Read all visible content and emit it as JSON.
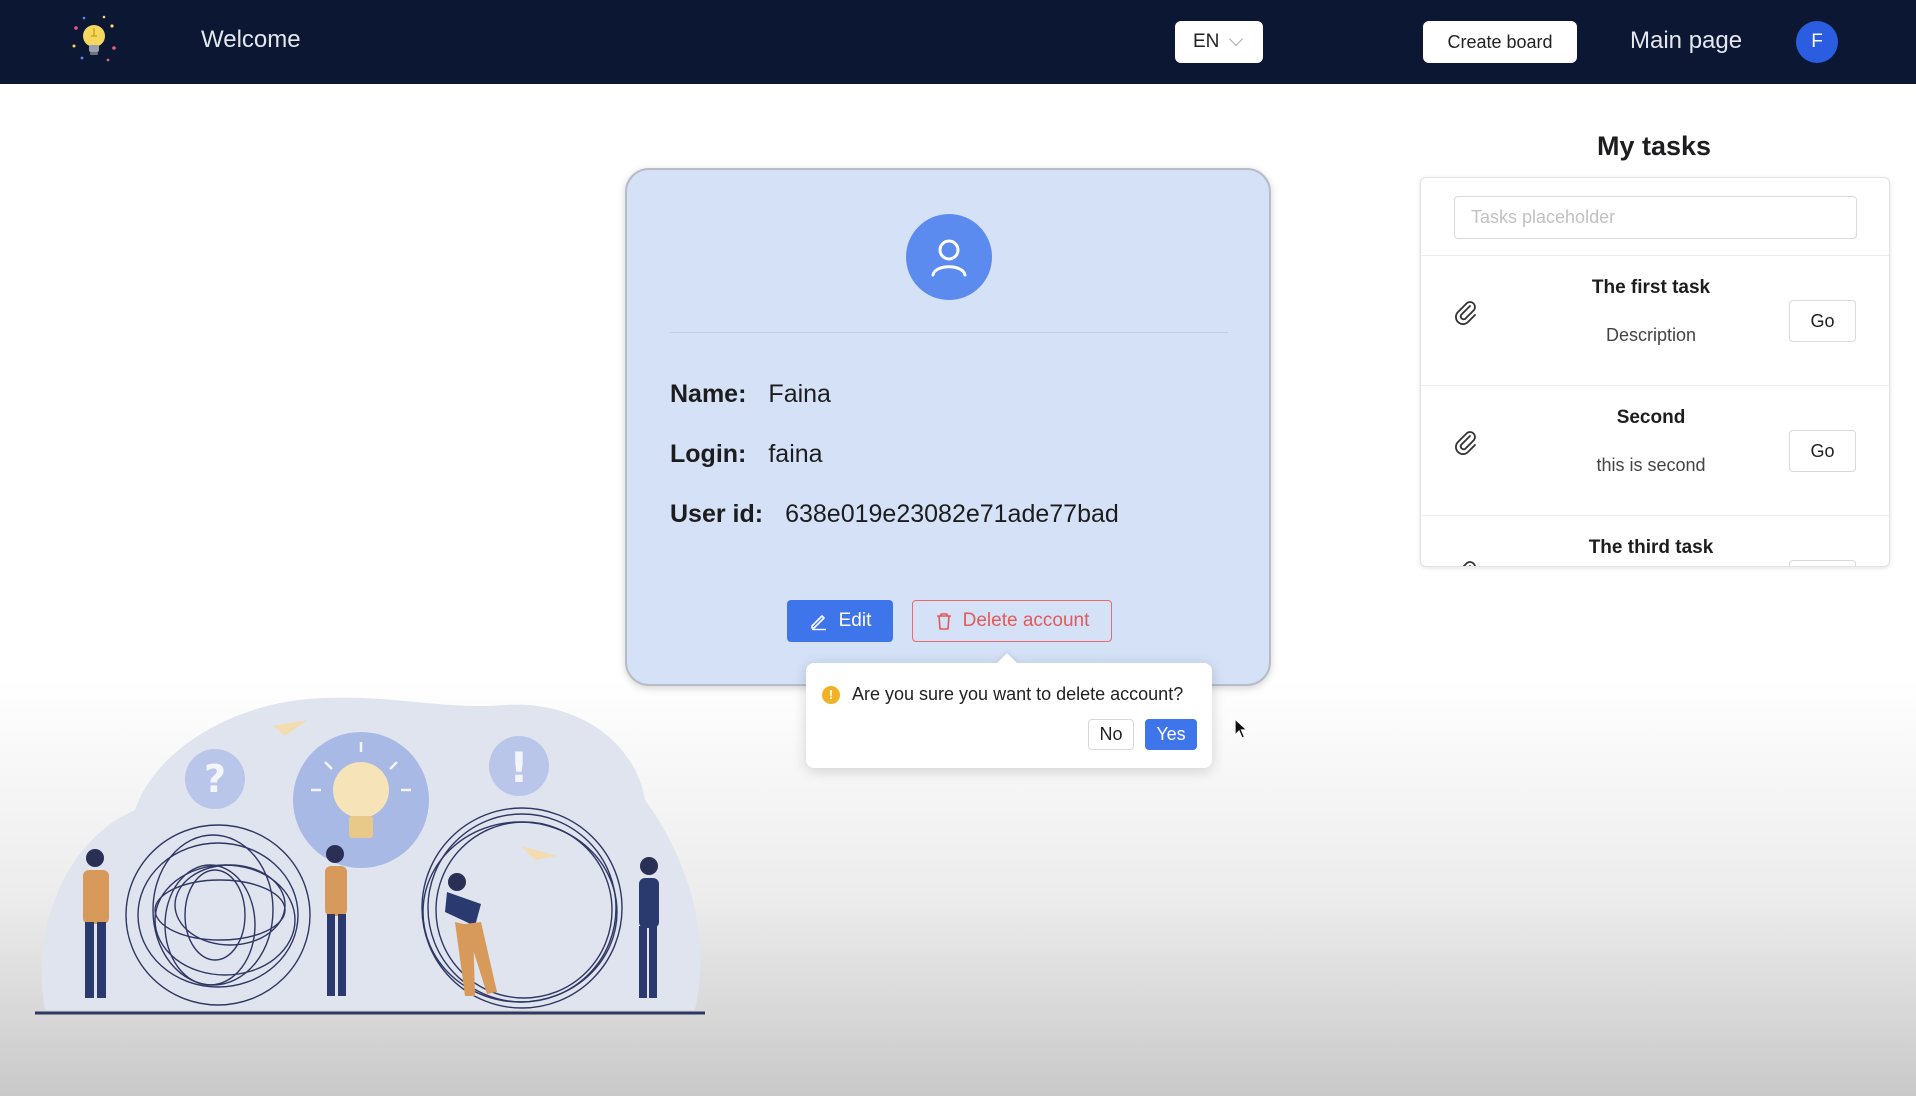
{
  "header": {
    "welcome": "Welcome",
    "language": "EN",
    "create_board": "Create board",
    "main_page": "Main page",
    "user_initial": "F"
  },
  "profile": {
    "name_label": "Name:",
    "name_value": "Faina",
    "login_label": "Login:",
    "login_value": "faina",
    "userid_label": "User id:",
    "userid_value": "638e019e23082e71ade77bad",
    "edit_label": "Edit",
    "delete_label": "Delete account"
  },
  "confirm": {
    "message": "Are you sure you want to delete account?",
    "no_label": "No",
    "yes_label": "Yes"
  },
  "tasks": {
    "title": "My tasks",
    "search_placeholder": "Tasks placeholder",
    "items": [
      {
        "title": "The first task",
        "description": "Description",
        "go_label": "Go"
      },
      {
        "title": "Second",
        "description": "this is second",
        "go_label": "Go"
      },
      {
        "title": "The third task",
        "description": "",
        "go_label": "Go"
      }
    ]
  },
  "colors": {
    "header_bg": "#0b1733",
    "card_bg": "#d4e1f6",
    "accent": "#3f75ea",
    "danger": "#e25a5a",
    "warning": "#f1b226"
  },
  "icons": {
    "logo": "lightbulb-logo-icon",
    "avatar": "user-icon",
    "edit": "pencil-icon",
    "delete": "trash-icon",
    "warning": "exclamation-circle-icon",
    "task": "paperclip-icon",
    "language": "chevron-down-icon"
  }
}
